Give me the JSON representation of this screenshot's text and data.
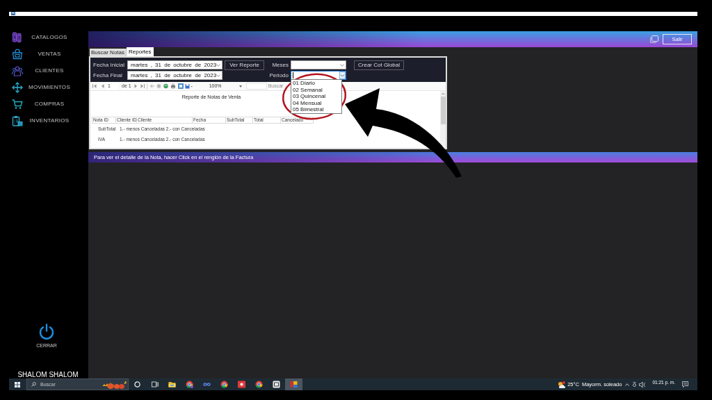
{
  "sidebar": {
    "items": [
      {
        "label": "CATALOGOS"
      },
      {
        "label": "VENTAS"
      },
      {
        "label": "CLIENTES"
      },
      {
        "label": "MOVIMIENTOS"
      },
      {
        "label": "COMPRAS"
      },
      {
        "label": "INVENTARIOS"
      }
    ],
    "power_label": "CERRAR",
    "user_name": "SHALOM SHALOM"
  },
  "header": {
    "exit_button": "Salir"
  },
  "tabs": [
    {
      "label": "Buscar Notas",
      "selected": false
    },
    {
      "label": "Reportes",
      "selected": true
    }
  ],
  "filters": {
    "start": {
      "label": "Fecha Inicial",
      "value": "martes , 31 de octubre de 2023"
    },
    "end": {
      "label": "Fecha Final",
      "value": "martes , 31 de octubre de 2023"
    },
    "report_button": "Ver Reporte",
    "months": {
      "label": "Meses"
    },
    "period": {
      "label": "Periodo",
      "expanded": true,
      "options": [
        {
          "label": "01 Diario",
          "selected": false
        },
        {
          "label": "02 Semanal",
          "selected": false
        },
        {
          "label": "03 Quincenal",
          "selected": false
        },
        {
          "label": "04 Mensual",
          "selected": false
        },
        {
          "label": "05 Bimestral",
          "selected": false
        }
      ]
    },
    "global_button": "Crear Cot Global"
  },
  "report_toolbar": {
    "page": "1",
    "page_count": "de 1",
    "zoom": "100%",
    "find_link": "Buscar"
  },
  "report": {
    "title": "Reporte de Notas de Venta",
    "columns": [
      "Nota ID",
      "Cliente ID",
      "Cliente",
      "Fecha",
      "SubTotal",
      "Total",
      "Cancelado"
    ],
    "rows": [
      {
        "label": "SubTotal",
        "text": "1.- menos Canceladas 2.- con Canceladas"
      },
      {
        "label": "IVA",
        "text": "1.- menos Canceladas 2.- con Canceladas"
      }
    ]
  },
  "hint_bar": "Para ver el detalle de la Nota, hacer Click en el renglón de la Factura",
  "taskbar": {
    "search_placeholder": "Buscar",
    "apps": [
      {
        "selected": false
      },
      {
        "selected": false
      },
      {
        "selected": false
      },
      {
        "selected": false
      },
      {
        "selected": false
      },
      {
        "selected": false
      },
      {
        "selected": false
      },
      {
        "selected": true
      }
    ],
    "weather": {
      "temperature": "25°C",
      "summary": "Mayorm. soleado"
    },
    "time": "01:21 p. m."
  }
}
